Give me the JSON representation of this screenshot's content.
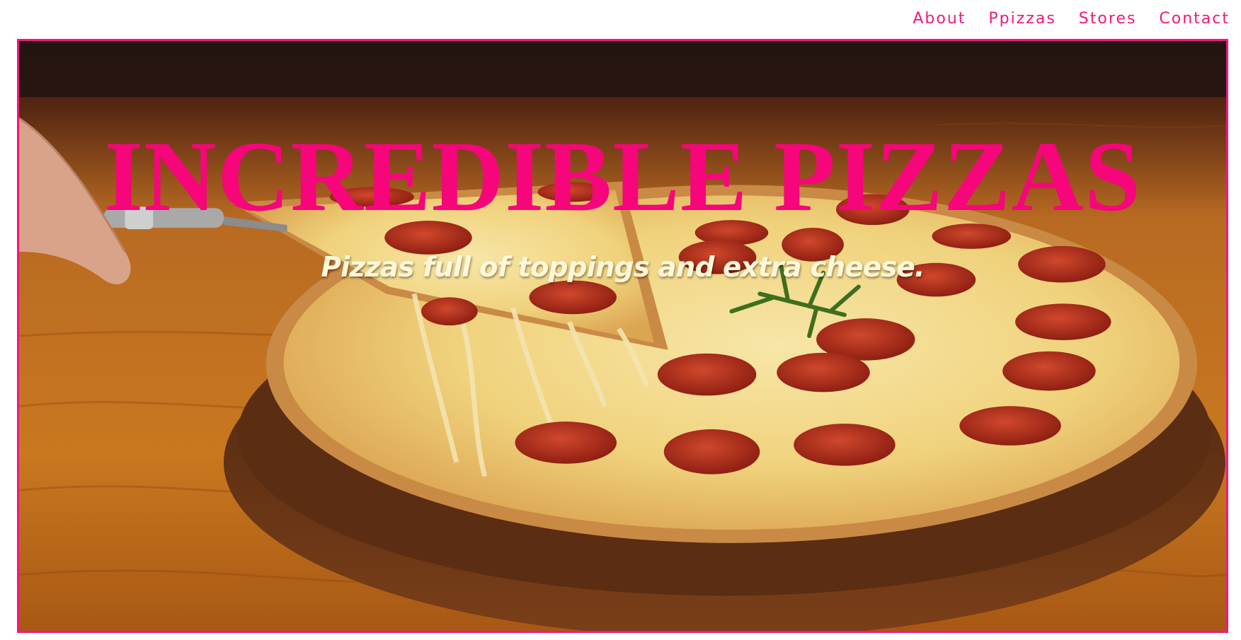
{
  "nav": {
    "items": [
      {
        "label": "About"
      },
      {
        "label": "Ppizzas"
      },
      {
        "label": "Stores"
      },
      {
        "label": "Contact"
      }
    ]
  },
  "hero": {
    "title": "INCREDIBLE PIZZAS",
    "subtitle": "Pizzas full of toppings and extra cheese.",
    "image_subject": "pepperoni-pizza-photo"
  },
  "colors": {
    "accent": "#f0197d",
    "title": "#f7057a",
    "subtitle": "#fff7d8"
  }
}
